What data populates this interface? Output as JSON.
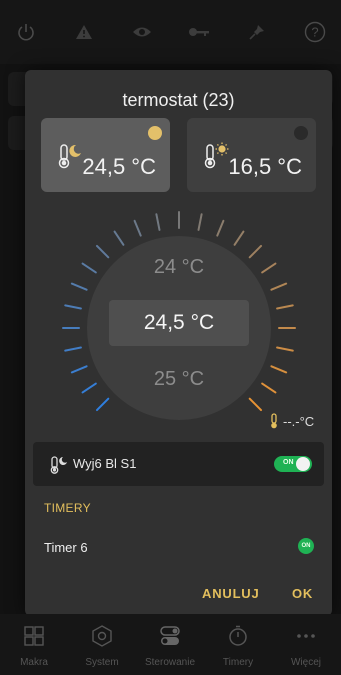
{
  "topbar": {
    "icons": [
      "power-icon",
      "warning-icon",
      "eye-icon",
      "key-icon",
      "pin-icon",
      "help-icon"
    ],
    "help_label": "?"
  },
  "dialog": {
    "title": "termostat (23)",
    "preset_left": {
      "value": "24,5 °C",
      "icon": "thermometer-moon-icon",
      "dot_color": "#e3c06a"
    },
    "preset_right": {
      "value": "16,5 °C",
      "icon": "thermometer-sun-icon",
      "dot_color": "#2a2a2a"
    },
    "dial": {
      "upper": "24 °C",
      "current": "24,5 °C",
      "lower": "25 °C",
      "cold_color": "#2f7fe0",
      "warm_color": "#e89334"
    },
    "external_temp": "--.-°C",
    "output": {
      "label": "Wyj6 Bl S1",
      "toggle": "ON"
    },
    "section": "TIMERY",
    "timer": {
      "label": "Timer  6",
      "badge": "ON"
    },
    "buttons": {
      "cancel": "ANULUJ",
      "ok": "OK"
    }
  },
  "bottom_nav": {
    "items": [
      {
        "label": "Makra",
        "icon": "macros-icon"
      },
      {
        "label": "System",
        "icon": "system-icon"
      },
      {
        "label": "Sterowanie",
        "icon": "control-icon"
      },
      {
        "label": "Timery",
        "icon": "timer-icon"
      },
      {
        "label": "Więcej",
        "icon": "more-icon"
      }
    ]
  }
}
